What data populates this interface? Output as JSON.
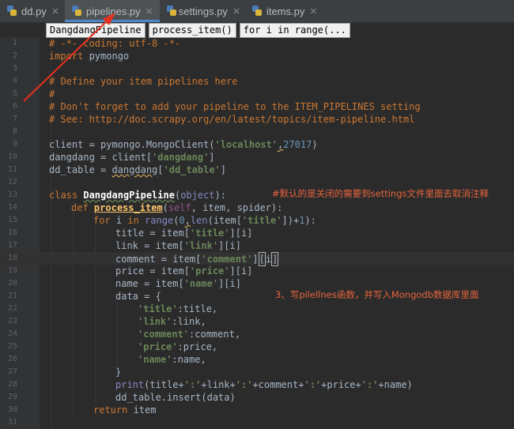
{
  "tabs": [
    {
      "label": "dd.py",
      "close": "×"
    },
    {
      "label": "pipelines.py",
      "close": "×"
    },
    {
      "label": "settings.py",
      "close": "×"
    },
    {
      "label": "items.py",
      "close": "×"
    }
  ],
  "breadcrumbs": [
    "DangdangPipeline",
    "process_item()",
    "for i in range(..."
  ],
  "line_numbers": [
    "1",
    "2",
    "3",
    "4",
    "5",
    "6",
    "7",
    "8",
    "9",
    "10",
    "11",
    "12",
    "13",
    "14",
    "15",
    "16",
    "17",
    "18",
    "19",
    "20",
    "21",
    "22",
    "23",
    "24",
    "25",
    "26",
    "27",
    "28",
    "29",
    "30",
    "31"
  ],
  "code": {
    "l1": "# -*- coding: utf-8 -*-",
    "l2_kw": "import",
    "l2_rest": " pymongo",
    "l4": "# Define your item pipelines here",
    "l5": "#",
    "l6": "# Don't forget to add your pipeline to the ITEM_PIPELINES setting",
    "l7": "# See: http://doc.scrapy.org/en/latest/topics/item-pipeline.html",
    "l9_a": "client = pymongo.MongoClient(",
    "l9_str": "'localhost'",
    "l9_comma": ",",
    "l9_num": "27017",
    "l9_end": ")",
    "l10_a": "dangdang = client[",
    "l10_str": "'dangdang'",
    "l10_end": "]",
    "l11_a": "dd_table = ",
    "l11_b": "dangdang",
    "l11_c": "[",
    "l11_str": "'dd_table'",
    "l11_end": "]",
    "l13_kw": "class",
    "l13_name": "DangdangPipeline",
    "l13_paren": "(",
    "l13_base": "object",
    "l13_end": "):",
    "l14_kw": "def",
    "l14_name": "process_item",
    "l14_open": "(",
    "l14_self": "self",
    "l14_args": ", item, spider):",
    "l15_kw": "for",
    "l15_a": " i ",
    "l15_in": "in",
    "l15_b": " ",
    "l15_range": "range",
    "l15_c": "(",
    "l15_zero": "0",
    "l15_comma": ",",
    "l15_len": "len",
    "l15_d": "(item[",
    "l15_str": "'title'",
    "l15_e": "])+",
    "l15_one": "1",
    "l15_end": "):",
    "l16_a": "title = item[",
    "l16_str": "'title'",
    "l16_end": "][i]",
    "l17_a": "link = item[",
    "l17_str": "'link'",
    "l17_end": "][i]",
    "l18_a": "comment = item[",
    "l18_str": "'comment'",
    "l18_b": "]",
    "l18_c": "[",
    "l18_i": "i",
    "l18_end": "]",
    "l19_a": "price = item[",
    "l19_str": "'price'",
    "l19_end": "][i]",
    "l20_a": "name = item[",
    "l20_str": "'name'",
    "l20_end": "][i]",
    "l21": "data = {",
    "l22_str": "'title'",
    "l22_rest": ":title,",
    "l23_str": "'link'",
    "l23_rest": ":link,",
    "l24_str": "'comment'",
    "l24_rest": ":comment,",
    "l25_str": "'price'",
    "l25_rest": ":price,",
    "l26_str": "'name'",
    "l26_rest": ":name,",
    "l27": "}",
    "l28_print": "print",
    "l28_a": "(title+",
    "l28_s1": "':'",
    "l28_b": "+link+",
    "l28_s2": "':'",
    "l28_c": "+comment+",
    "l28_s3": "':'",
    "l28_d": "+price+",
    "l28_s4": "':'",
    "l28_e": "+name)",
    "l29": "dd_table.insert(data)",
    "l30_kw": "return",
    "l30_rest": " item"
  },
  "annotations": {
    "note1": "#默认的是关闭的需要到settings文件里面去取消注释",
    "note2": "3、写pilellnes函数，并写入Mongodb数据库里面"
  },
  "colors": {
    "annotation": "#e8643c",
    "active_tab_accent": "#4a88c7"
  }
}
